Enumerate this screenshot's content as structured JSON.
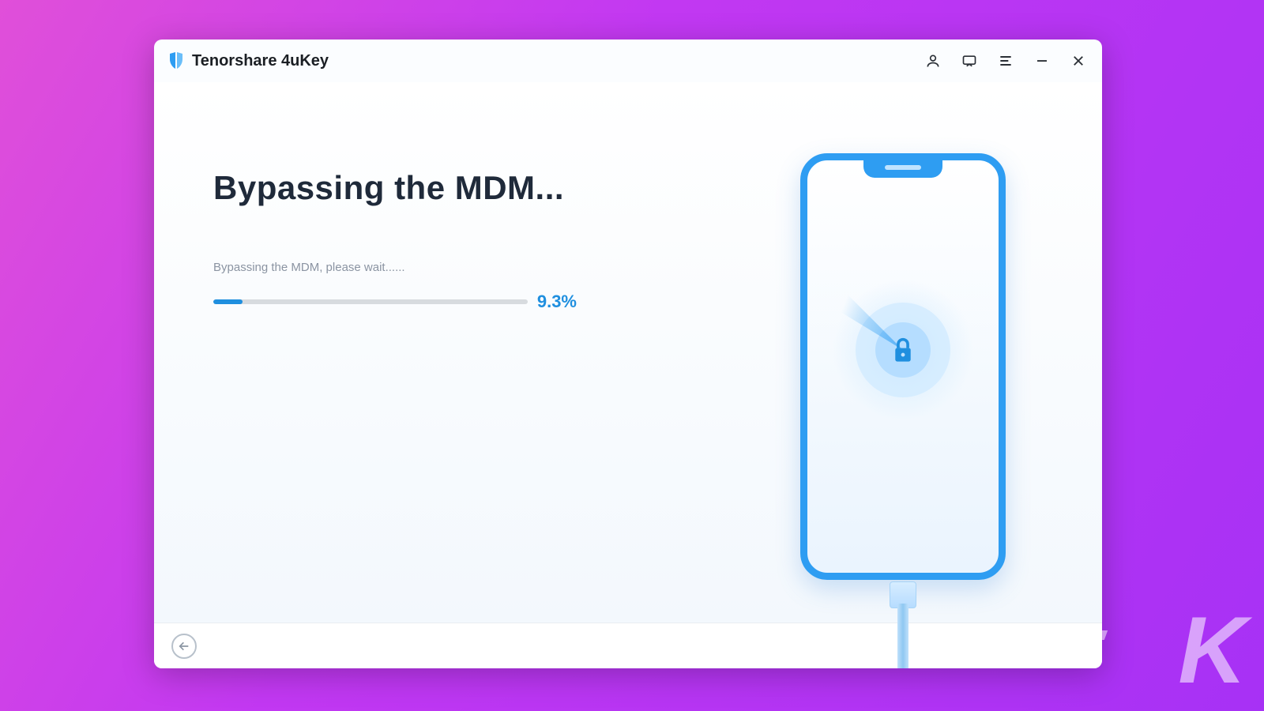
{
  "app": {
    "title": "Tenorshare 4uKey",
    "titlebar": {
      "account_icon": "user-icon",
      "feedback_icon": "message-icon",
      "menu_icon": "menu-lines-icon",
      "minimize_icon": "minimize-icon",
      "close_icon": "close-icon"
    }
  },
  "main": {
    "heading": "Bypassing the MDM...",
    "status_line": "Bypassing the MDM, please wait......",
    "progress_percent": 9.3,
    "progress_label": "9.3%"
  },
  "illustration": {
    "device": "phone-icon",
    "center_icon": "lock-icon"
  },
  "footer": {
    "back_icon": "arrow-left-icon"
  },
  "colors": {
    "accent": "#1f8fdf",
    "heading": "#1f2a3a",
    "muted": "#8b94a2"
  }
}
